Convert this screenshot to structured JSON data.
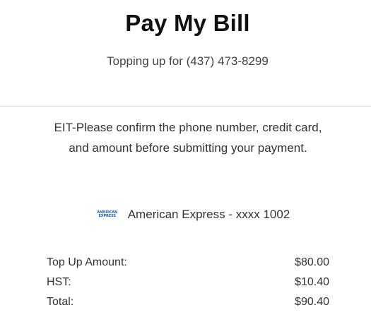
{
  "header": {
    "title": "Pay My Bill",
    "subtitle": "Topping up for (437) 473-8299"
  },
  "notice": {
    "text": "EIT-Please confirm the phone number, credit card, and amount before submitting your payment."
  },
  "payment_method": {
    "logo_line1": "AMERICAN",
    "logo_line2": "EXPRESS",
    "label": "American Express - xxxx 1002",
    "logo_color": "#1f5fa8"
  },
  "summary": {
    "rows": [
      {
        "label": "Top Up Amount:",
        "value": "$80.00"
      },
      {
        "label": "HST:",
        "value": "$10.40"
      },
      {
        "label": "Total:",
        "value": "$90.40"
      }
    ]
  }
}
